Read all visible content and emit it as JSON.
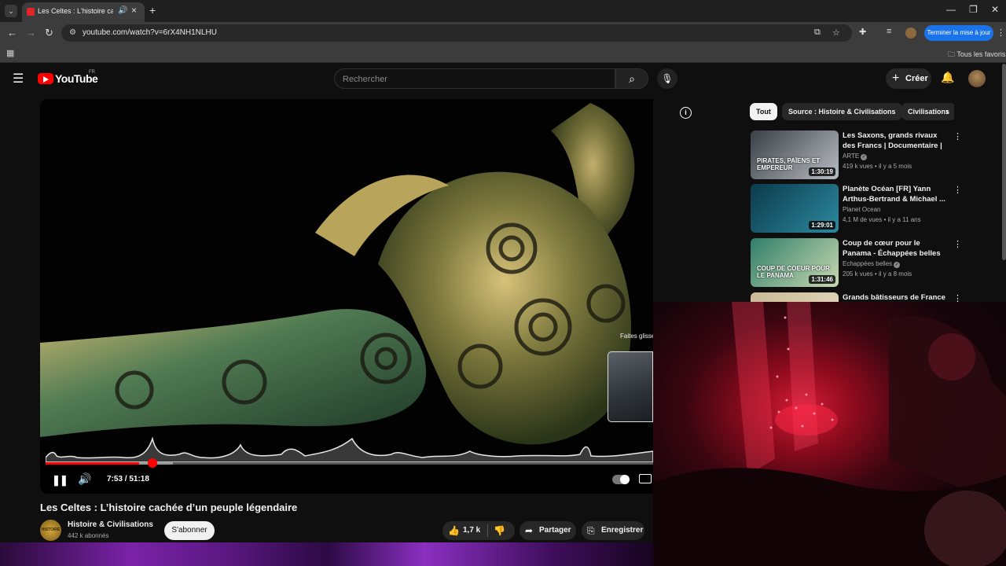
{
  "browser": {
    "tab_title": "Les Celtes : L'histoire caché",
    "url": "youtube.com/watch?v=6rX4NH1NLHU",
    "update_button": "Terminer la mise à jour",
    "bookmarks_folder": "Tous les favoris"
  },
  "header": {
    "logo_text": "YouTube",
    "region": "FR",
    "search_placeholder": "Rechercher",
    "create_label": "Créer"
  },
  "player": {
    "time_display": "7:53 / 51:18",
    "progress_played": 0.154,
    "progress_buffered": 0.21,
    "seek_hint": "Faites glisser pour rechercher"
  },
  "video": {
    "title": "Les Celtes : L’histoire cachée d’un peuple légendaire",
    "channel": "Histoire & Civilisations",
    "channel_avatar_text": "HISTOIRE",
    "subscribers": "442 k abonnés",
    "subscribe_label": "S'abonner",
    "likes": "1,7 k",
    "share_label": "Partager",
    "save_label": "Enregistrer"
  },
  "chips": [
    "Tout",
    "Source : Histoire & Civilisations",
    "Civilisations"
  ],
  "recommendations": [
    {
      "title": "Les Saxons, grands rivaux des Francs | Documentaire | ARTE",
      "channel": "ARTE",
      "verified": true,
      "meta": "419 k vues • il y a 5 mois",
      "duration": "1:30:19",
      "thumb_text": "PIRATES, PAÏENS ET EMPEREUR",
      "color_a": "#3a3f46",
      "color_b": "#b8bcc2"
    },
    {
      "title": "Planète Océan [FR] Yann Arthus-Bertrand & Michael ...",
      "channel": "Planet Ocean",
      "verified": false,
      "meta": "4,1 M de vues • il y a 11 ans",
      "duration": "1:29:01",
      "thumb_text": "",
      "color_a": "#0b3a4a",
      "color_b": "#2d8aa0"
    },
    {
      "title": "Coup de cœur pour le Panama - Échappées belles",
      "channel": "Echappées belles",
      "verified": true,
      "meta": "205 k vues • il y a 8 mois",
      "duration": "1:31:46",
      "thumb_text": "COUP DE COEUR POUR LE PANAMA",
      "color_a": "#2f7f6a",
      "color_b": "#c9d8b0"
    },
    {
      "title": "Grands bâtisseurs de France :",
      "channel": "",
      "verified": false,
      "meta": "",
      "duration": "",
      "thumb_text": "",
      "color_a": "#c8b896",
      "color_b": "#e8dcc0"
    }
  ]
}
